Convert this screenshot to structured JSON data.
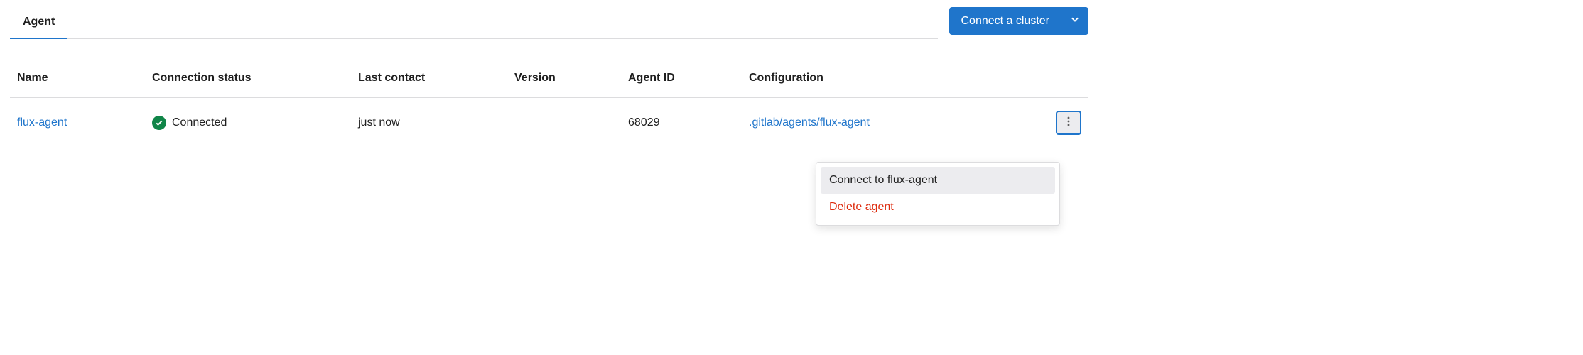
{
  "tabs": [
    {
      "label": "Agent"
    }
  ],
  "connect_cluster": {
    "label": "Connect a cluster"
  },
  "columns": {
    "name": "Name",
    "status": "Connection status",
    "last_contact": "Last contact",
    "version": "Version",
    "agent_id": "Agent ID",
    "configuration": "Configuration"
  },
  "rows": [
    {
      "name": "flux-agent",
      "status": "Connected",
      "last_contact": "just now",
      "version": "",
      "agent_id": "68029",
      "configuration": ".gitlab/agents/flux-agent"
    }
  ],
  "menu": {
    "connect": "Connect to flux-agent",
    "delete": "Delete agent"
  }
}
